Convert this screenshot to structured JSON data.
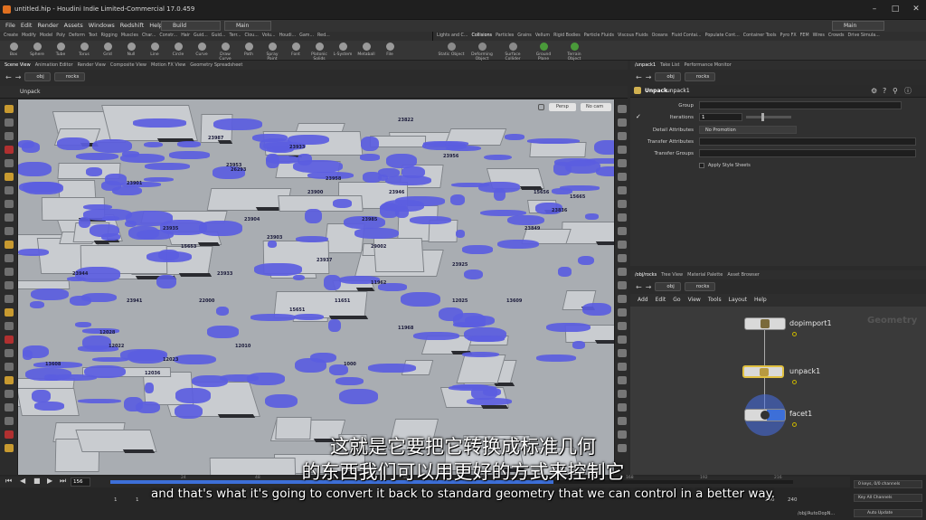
{
  "window": {
    "title": "untitled.hip - Houdini Indie Limited-Commercial 17.0.459",
    "desktop_left": "Build",
    "desktop_mid": "Main",
    "desktop_right": "Main"
  },
  "menu": [
    "File",
    "Edit",
    "Render",
    "Assets",
    "Windows",
    "Redshift",
    "Help"
  ],
  "shelf_tabs_left": [
    "Create",
    "Modify",
    "Model",
    "Poly",
    "Deform",
    "Text",
    "Rigging",
    "Muscles",
    "Char...",
    "Constr...",
    "Hair",
    "Guid...",
    "Guid...",
    "Terr...",
    "Clou...",
    "Volu...",
    "Houdi...",
    "Gam...",
    "Red..."
  ],
  "shelf_tabs_right": [
    "Lights and C...",
    "Collisions",
    "Particles",
    "Grains",
    "Vellum",
    "Rigid Bodies",
    "Particle Fluids",
    "Viscous Fluids",
    "Oceans",
    "Fluid Contai...",
    "Populate Cont...",
    "Container Tools",
    "Pyro FX",
    "FEM",
    "Wires",
    "Crowds",
    "Drive Simula..."
  ],
  "shelf_tools_left": [
    "Box",
    "Sphere",
    "Tube",
    "Torus",
    "Grid",
    "Null",
    "Line",
    "Circle",
    "Curve",
    "Draw Curve",
    "Path",
    "Spray Paint",
    "Font",
    "Platonic Solids",
    "L-System",
    "Metaball",
    "File"
  ],
  "shelf_tools_right": [
    "Static Object",
    "Deforming Object",
    "Surface Collider",
    "Ground Plane",
    "Terrain Object"
  ],
  "viewport_tabs": [
    "Scene View",
    "Animation Editor",
    "Render View",
    "Composite View",
    "Motion FX View",
    "Geometry Spreadsheet"
  ],
  "viewport_path": [
    "obj",
    "rocks"
  ],
  "viewport_title": "Unpack",
  "viewport_buttons": {
    "persp": "Persp",
    "cam": "No cam"
  },
  "point_numbers": [
    "23953",
    "23958",
    "23933",
    "23946",
    "23985",
    "23987",
    "23956",
    "23822",
    "26293",
    "23904",
    "23903",
    "23900",
    "23935",
    "23901",
    "23849",
    "23836",
    "15665",
    "15656",
    "15653",
    "23933",
    "29002",
    "23925",
    "23941",
    "22000",
    "23937",
    "11651",
    "11962",
    "11968",
    "12028",
    "12022",
    "12036",
    "13608",
    "12023",
    "12025",
    "12010",
    "15651",
    "1000",
    "23944",
    "13609"
  ],
  "timeline": {
    "frame": "156",
    "start": "1",
    "start2": "1",
    "end": "240",
    "end2": "240",
    "ticks": [
      "24",
      "48",
      "72",
      "96",
      "120",
      "144",
      "168",
      "192",
      "216"
    ],
    "keys": "0 keys, 0/0 channels",
    "key_all": "Key All Channels",
    "auto_update": "Auto Update",
    "path": "/obj/AutoDopN..."
  },
  "param_tabs": [
    "/unpack1",
    "Take List",
    "Performance Monitor"
  ],
  "param_path": [
    "obj",
    "rocks"
  ],
  "param_node": {
    "type": "Unpack",
    "name": "unpack1"
  },
  "params": {
    "group_label": "Group",
    "group_value": "",
    "iterations_label": "Iterations",
    "iterations_value": "1",
    "detail_label": "Detail Attributes",
    "detail_value": "No Promotion",
    "transfer_label": "Transfer Attributes",
    "transfer_value": "",
    "transfer_groups_label": "Transfer Groups",
    "transfer_groups_value": "",
    "apply_style_label": "Apply Style Sheets"
  },
  "net_tabs": [
    "/obj/rocks",
    "Tree View",
    "Material Palette",
    "Asset Browser"
  ],
  "net_path": [
    "obj",
    "rocks"
  ],
  "net_menu": [
    "Add",
    "Edit",
    "Go",
    "View",
    "Tools",
    "Layout",
    "Help"
  ],
  "net_context": "Geometry",
  "nodes": [
    {
      "name": "dopimport1"
    },
    {
      "name": "unpack1"
    },
    {
      "name": "facet1"
    }
  ],
  "subtitles": {
    "zh_line1": "这就是它要把它转换成标准几何",
    "zh_line2": "的东西我们可以用更好的方式来控制它",
    "en": "and that's what it's going to convert it back to standard geometry that we can control in a better way."
  },
  "colors": {
    "accent": "#5b5de0",
    "node_blue": "#3d6fd8",
    "flag": "#c8b400"
  }
}
